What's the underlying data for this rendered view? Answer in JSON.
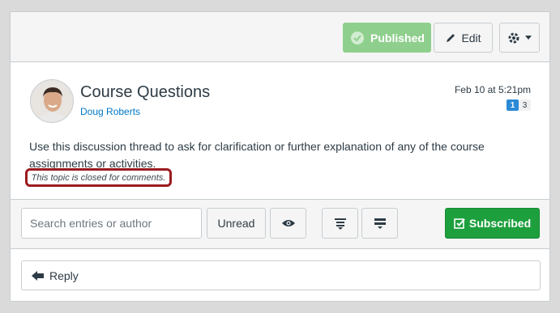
{
  "header": {
    "published_label": "Published",
    "edit_label": "Edit"
  },
  "topic": {
    "title": "Course Questions",
    "author": "Doug Roberts",
    "date": "Feb 10 at 5:21pm",
    "unread_count": "1",
    "total_count": "3",
    "body": "Use this discussion thread to ask for clarification or further explanation of any of the course assignments or activities.",
    "closed_note": "This topic is closed for comments."
  },
  "toolbar": {
    "search_placeholder": "Search entries or author",
    "unread_label": "Unread",
    "subscribed_label": "Subscribed"
  },
  "reply": {
    "label": "Reply"
  },
  "colors": {
    "published": "#8fcf8d",
    "subscribed": "#1d9f3d",
    "link": "#0077c8",
    "highlight": "#9b1b1f"
  }
}
